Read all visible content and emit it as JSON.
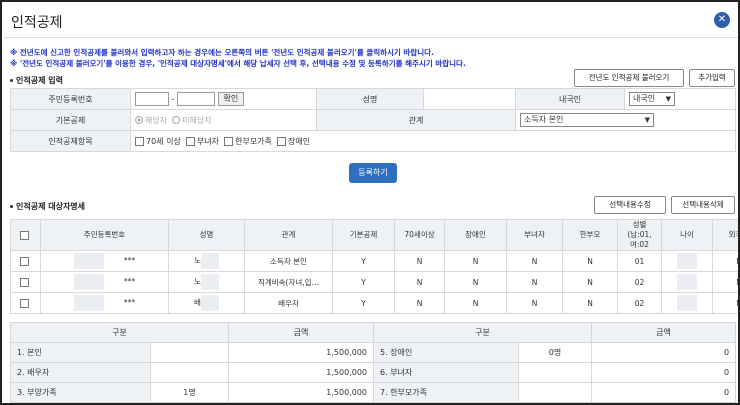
{
  "window": {
    "title": "인적공제"
  },
  "notices": [
    "※ 전년도에 신고한 인적공제를 불러와서 입력하고자 하는 경우에는 오른쪽의 버튼 '전년도 인적공제 불러오기'를 클릭하시기 바랍니다.",
    "※ '전년도 인적공제 불러오기'를 이용한 경우, '인적공제 대상자명세'에서 해당 납세자 선택 후, 선택내용 수정 및 등록하기를 해주시기 바랍니다."
  ],
  "input_section": {
    "title": "인적공제 입력",
    "prev_year_button": "전년도 인적공제 불러오기",
    "add_button": "추가입력",
    "row1": {
      "id_label": "주민등록번호",
      "dash": "-",
      "confirm_button": "확인",
      "name_label": "성명",
      "nationality_label": "내국인",
      "nationality_value": "내국인"
    },
    "row2": {
      "basic_label": "기본공제",
      "radio_yes": "해당자",
      "radio_no": "미해당자",
      "relation_label": "관계",
      "relation_value": "소득자 본인"
    },
    "row3": {
      "items_label": "인적공제항목",
      "checks": [
        "70세 이상",
        "부녀자",
        "한부모가족",
        "장애인"
      ]
    },
    "register_button": "등록하기"
  },
  "list_section": {
    "title": "인적공제 대상자명세",
    "edit_button": "선택내용수정",
    "delete_button": "선택내용삭제",
    "headers": [
      "주민등록번호",
      "성명",
      "관계",
      "기본공제",
      "70세이상",
      "장애인",
      "부녀자",
      "한부모",
      "성별\n(남:01,여:02",
      "나이",
      "외국인"
    ],
    "rows": [
      {
        "id": "***",
        "name": "노",
        "relation": "소득자 본인",
        "basic": "Y",
        "over70": "N",
        "disabled": "N",
        "female": "N",
        "single": "N",
        "gender": "01",
        "age": "",
        "foreign": "N"
      },
      {
        "id": "***",
        "name": "노",
        "relation": "직계비속(자녀,입…",
        "basic": "Y",
        "over70": "N",
        "disabled": "N",
        "female": "N",
        "single": "N",
        "gender": "02",
        "age": "",
        "foreign": "N"
      },
      {
        "id": "***",
        "name": "배",
        "relation": "배우자",
        "basic": "Y",
        "over70": "N",
        "disabled": "N",
        "female": "N",
        "single": "N",
        "gender": "02",
        "age": "",
        "foreign": "N"
      }
    ]
  },
  "summary": {
    "headers": [
      "구분",
      "금액",
      "구분",
      "금액"
    ],
    "rows": [
      {
        "k1": "1. 본인",
        "c1": "",
        "v1": "1,500,000",
        "k2": "5. 장애인",
        "c2": "0명",
        "v2": "0"
      },
      {
        "k1": "2. 배우자",
        "c1": "",
        "v1": "1,500,000",
        "k2": "6. 부녀자",
        "c2": "",
        "v2": "0"
      },
      {
        "k1": "3. 부양가족",
        "c1": "1명",
        "v1": "1,500,000",
        "k2": "7. 한부모가족",
        "c2": "",
        "v2": "0"
      }
    ]
  },
  "colors": {
    "accent": "#2f6fc0",
    "notice": "#1f30c8",
    "header_bg": "#eef2f6"
  }
}
